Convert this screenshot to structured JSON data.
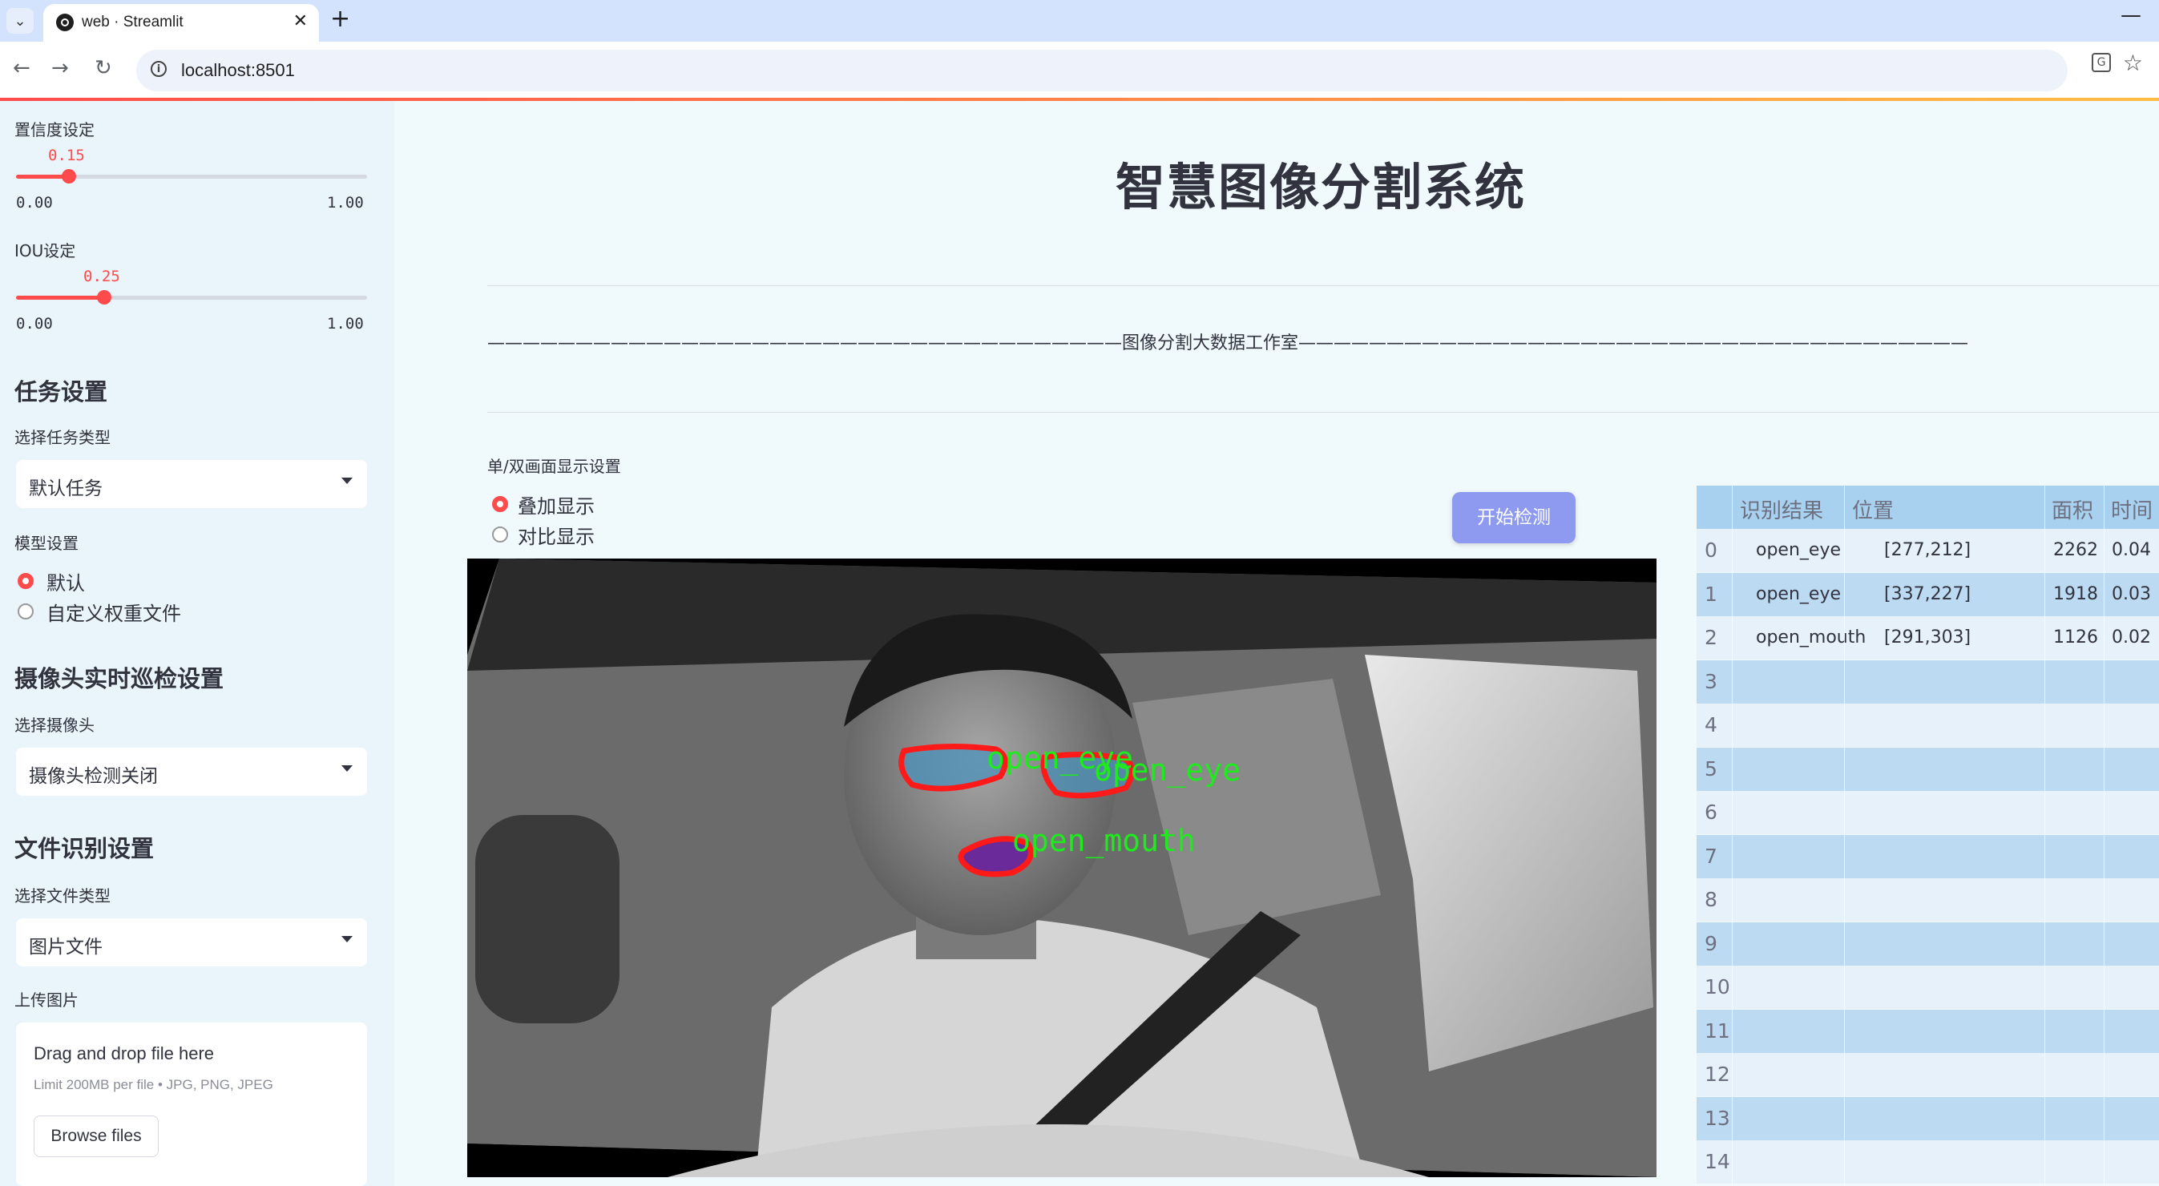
{
  "browser": {
    "tab_title": "web · Streamlit",
    "url": "localhost:8501",
    "new_tab": "+",
    "close": "✕",
    "minimize": "—"
  },
  "sidebar": {
    "confidence": {
      "label": "置信度设定",
      "value": "0.15",
      "min": "0.00",
      "max": "1.00",
      "fraction": 0.15
    },
    "iou": {
      "label": "IOU设定",
      "value": "0.25",
      "min": "0.00",
      "max": "1.00",
      "fraction": 0.25
    },
    "task_section": "任务设置",
    "task_type_label": "选择任务类型",
    "task_type_value": "默认任务",
    "model_label": "模型设置",
    "model_options": [
      {
        "label": "默认",
        "selected": true
      },
      {
        "label": "自定义权重文件",
        "selected": false
      }
    ],
    "camera_section": "摄像头实时巡检设置",
    "camera_label": "选择摄像头",
    "camera_value": "摄像头检测关闭",
    "file_section": "文件识别设置",
    "file_type_label": "选择文件类型",
    "file_type_value": "图片文件",
    "upload_label": "上传图片",
    "upload": {
      "title": "Drag and drop file here",
      "limit": "Limit 200MB per file • JPG, PNG, JPEG",
      "button": "Browse files"
    }
  },
  "main": {
    "title": "智慧图像分割系统",
    "banner": "————————————————————————————————————图像分割大数据工作室——————————————————————————————————————",
    "display_label": "单/双画面显示设置",
    "display_options": [
      {
        "label": "叠加显示",
        "selected": true
      },
      {
        "label": "对比显示",
        "selected": false
      }
    ],
    "start_button": "开始检测",
    "detections": [
      {
        "label": "open_eye"
      },
      {
        "label": "open_eye"
      },
      {
        "label": "open_mouth"
      }
    ]
  },
  "results_table": {
    "columns": [
      "识别结果",
      "位置",
      "面积",
      "时间"
    ],
    "rows": [
      {
        "index": "0",
        "result": "open_eye",
        "position": "[277,212]",
        "area": "2262",
        "time": "0.04"
      },
      {
        "index": "1",
        "result": "open_eye",
        "position": "[337,227]",
        "area": "1918",
        "time": "0.03"
      },
      {
        "index": "2",
        "result": "open_mouth",
        "position": "[291,303]",
        "area": "1126",
        "time": "0.02"
      },
      {
        "index": "3",
        "result": "",
        "position": "",
        "area": "",
        "time": ""
      },
      {
        "index": "4",
        "result": "",
        "position": "",
        "area": "",
        "time": ""
      },
      {
        "index": "5",
        "result": "",
        "position": "",
        "area": "",
        "time": ""
      },
      {
        "index": "6",
        "result": "",
        "position": "",
        "area": "",
        "time": ""
      },
      {
        "index": "7",
        "result": "",
        "position": "",
        "area": "",
        "time": ""
      },
      {
        "index": "8",
        "result": "",
        "position": "",
        "area": "",
        "time": ""
      },
      {
        "index": "9",
        "result": "",
        "position": "",
        "area": "",
        "time": ""
      },
      {
        "index": "10",
        "result": "",
        "position": "",
        "area": "",
        "time": ""
      },
      {
        "index": "11",
        "result": "",
        "position": "",
        "area": "",
        "time": ""
      },
      {
        "index": "12",
        "result": "",
        "position": "",
        "area": "",
        "time": ""
      },
      {
        "index": "13",
        "result": "",
        "position": "",
        "area": "",
        "time": ""
      },
      {
        "index": "14",
        "result": "",
        "position": "",
        "area": "",
        "time": ""
      }
    ]
  },
  "colors": {
    "accent": "#ff4b4b",
    "button": "#8e9af0",
    "table_header": "#a8d0ef",
    "table_alt": "#bcdbf3",
    "detection_outline": "#ff1a1a",
    "detection_label": "#1eea1e"
  }
}
